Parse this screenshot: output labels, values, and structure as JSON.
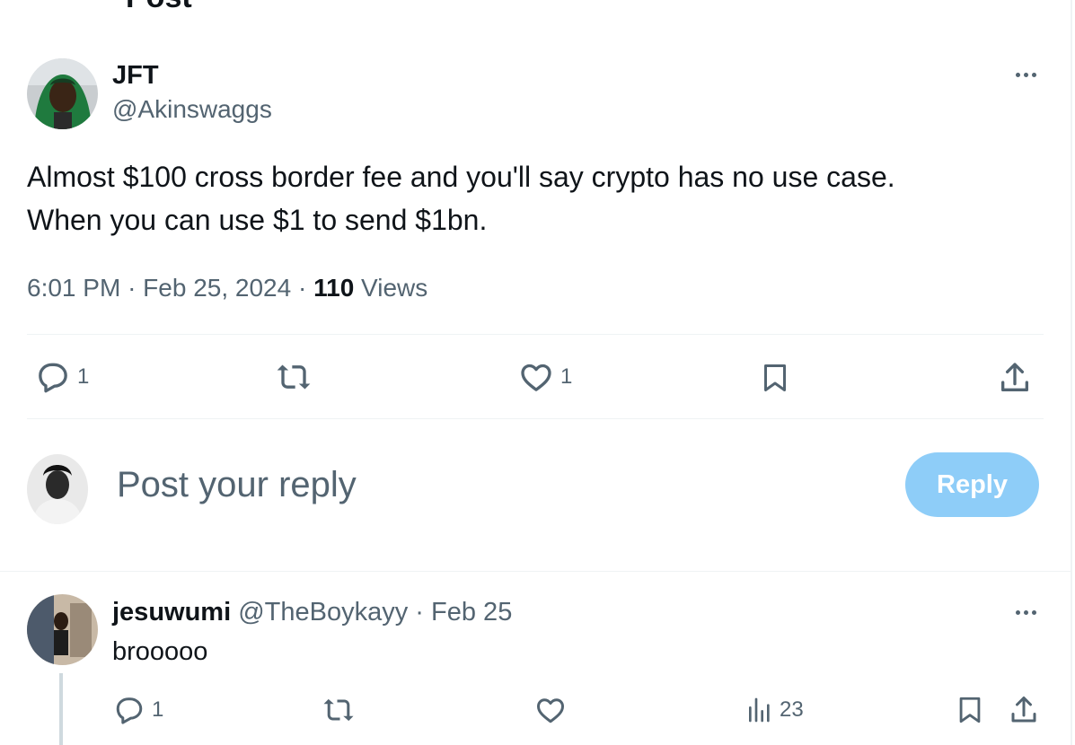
{
  "header": {
    "title_peek": "Post"
  },
  "post": {
    "author_name": "JFT",
    "author_handle": "@Akinswaggs",
    "text_line1": "Almost $100 cross border fee and you'll say crypto has no use case.",
    "text_line2": "When you can use $1 to send $1bn.",
    "time": "6:01 PM",
    "sep1": "·",
    "date": "Feb 25, 2024",
    "sep2": "·",
    "views_count": "110",
    "views_label": "Views",
    "actions": {
      "reply_count": "1",
      "like_count": "1"
    }
  },
  "composer": {
    "placeholder": "Post your reply",
    "button_label": "Reply"
  },
  "reply": {
    "name": "jesuwumi",
    "handle": "@TheBoykayy",
    "sep": "·",
    "date": "Feb 25",
    "text": "brooooo",
    "actions": {
      "reply_count": "1",
      "views_count": "23"
    }
  },
  "colors": {
    "text_primary": "#0f1419",
    "text_secondary": "#536471",
    "divider": "#eff3f4",
    "reply_button_disabled": "#8ecdf8"
  },
  "icons": [
    "more-icon",
    "reply-icon",
    "repost-icon",
    "like-icon",
    "bookmark-icon",
    "share-icon",
    "views-icon"
  ]
}
